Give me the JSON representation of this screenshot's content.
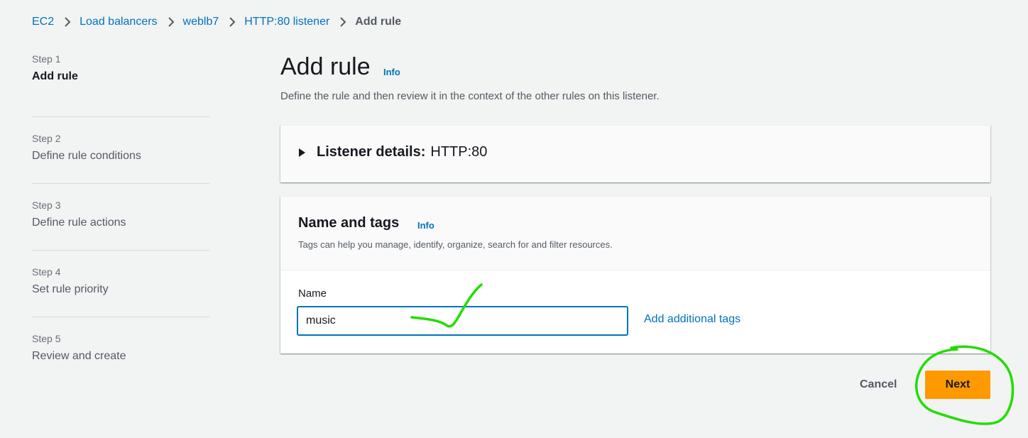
{
  "breadcrumb": {
    "items": [
      "EC2",
      "Load balancers",
      "weblb7",
      "HTTP:80 listener"
    ],
    "current": "Add rule"
  },
  "steps": [
    {
      "num": "Step 1",
      "title": "Add rule",
      "active": true
    },
    {
      "num": "Step 2",
      "title": "Define rule conditions"
    },
    {
      "num": "Step 3",
      "title": "Define rule actions"
    },
    {
      "num": "Step 4",
      "title": "Set rule priority"
    },
    {
      "num": "Step 5",
      "title": "Review and create"
    }
  ],
  "header": {
    "title": "Add rule",
    "info": "Info",
    "description": "Define the rule and then review it in the context of the other rules on this listener."
  },
  "listener": {
    "label": "Listener details:",
    "value": "HTTP:80"
  },
  "name_and_tags": {
    "title": "Name and tags",
    "info": "Info",
    "description": "Tags can help you manage, identify, organize, search for and filter resources.",
    "name_label": "Name",
    "name_value": "music",
    "add_tags_label": "Add additional tags"
  },
  "footer": {
    "cancel_label": "Cancel",
    "next_label": "Next"
  },
  "colors": {
    "link": "#0073bb",
    "primary_button": "#ff9900",
    "annotation": "#22dd00"
  }
}
